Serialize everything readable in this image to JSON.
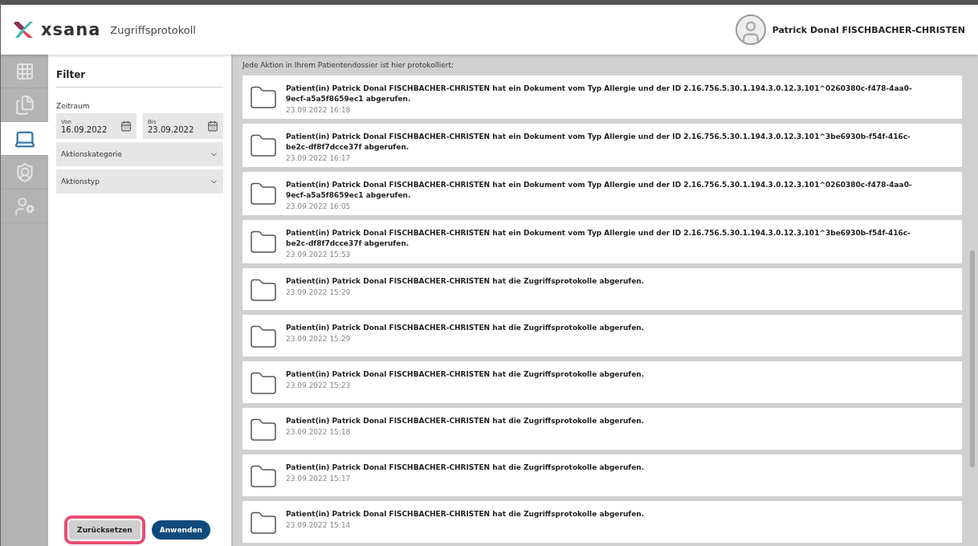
{
  "header": {
    "brand": "xsana",
    "title": "Zugriffsprotokoll",
    "user": "Patrick Donal FISCHBACHER-CHRISTEN"
  },
  "sidebar": {
    "items": [
      {
        "kind": "grid",
        "selected": false
      },
      {
        "kind": "documents",
        "selected": false
      },
      {
        "kind": "laptop",
        "selected": true
      },
      {
        "kind": "shield",
        "selected": false
      },
      {
        "kind": "user-settings",
        "selected": false
      }
    ]
  },
  "filter": {
    "title": "Filter",
    "period_label": "Zeitraum",
    "dates": [
      {
        "label": "Von",
        "value": "16.09.2022"
      },
      {
        "label": "Bis",
        "value": "23.09.2022"
      }
    ],
    "dropdowns": [
      {
        "label": "Aktionskategorie"
      },
      {
        "label": "Aktionstyp"
      }
    ],
    "buttons": [
      {
        "label": "Zurücksetzen",
        "kind": "secondary",
        "highlighted": true
      },
      {
        "label": "Anwenden",
        "kind": "primary",
        "highlighted": false
      }
    ]
  },
  "log": {
    "intro": "Jede Aktion in Ihrem Patientendossier ist hier protokolliert:",
    "entries": [
      {
        "text": "Patient(in) Patrick Donal FISCHBACHER-CHRISTEN hat ein Dokument vom Typ Allergie und der ID 2.16.756.5.30.1.194.3.0.12.3.101^0260380c-f478-4aa0-9ecf-a5a5f8659ec1 abgerufen.",
        "time": "23.09.2022 16:18"
      },
      {
        "text": "Patient(in) Patrick Donal FISCHBACHER-CHRISTEN hat ein Dokument vom Typ Allergie und der ID 2.16.756.5.30.1.194.3.0.12.3.101^3be6930b-f54f-416c-be2c-df8f7dcce37f abgerufen.",
        "time": "23.09.2022 16:17"
      },
      {
        "text": "Patient(in) Patrick Donal FISCHBACHER-CHRISTEN hat ein Dokument vom Typ Allergie und der ID 2.16.756.5.30.1.194.3.0.12.3.101^0260380c-f478-4aa0-9ecf-a5a5f8659ec1 abgerufen.",
        "time": "23.09.2022 16:05"
      },
      {
        "text": "Patient(in) Patrick Donal FISCHBACHER-CHRISTEN hat ein Dokument vom Typ Allergie und der ID 2.16.756.5.30.1.194.3.0.12.3.101^3be6930b-f54f-416c-be2c-df8f7dcce37f abgerufen.",
        "time": "23.09.2022 15:53"
      },
      {
        "text": "Patient(in) Patrick Donal FISCHBACHER-CHRISTEN hat die Zugriffsprotokolle abgerufen.",
        "time": "23.09.2022 15:29"
      },
      {
        "text": "Patient(in) Patrick Donal FISCHBACHER-CHRISTEN hat die Zugriffsprotokolle abgerufen.",
        "time": "23.09.2022 15:29"
      },
      {
        "text": "Patient(in) Patrick Donal FISCHBACHER-CHRISTEN hat die Zugriffsprotokolle abgerufen.",
        "time": "23.09.2022 15:23"
      },
      {
        "text": "Patient(in) Patrick Donal FISCHBACHER-CHRISTEN hat die Zugriffsprotokolle abgerufen.",
        "time": "23.09.2022 15:18"
      },
      {
        "text": "Patient(in) Patrick Donal FISCHBACHER-CHRISTEN hat die Zugriffsprotokolle abgerufen.",
        "time": "23.09.2022 15:17"
      },
      {
        "text": "Patient(in) Patrick Donal FISCHBACHER-CHRISTEN hat die Zugriffsprotokolle abgerufen.",
        "time": "23.09.2022 15:14"
      }
    ]
  }
}
